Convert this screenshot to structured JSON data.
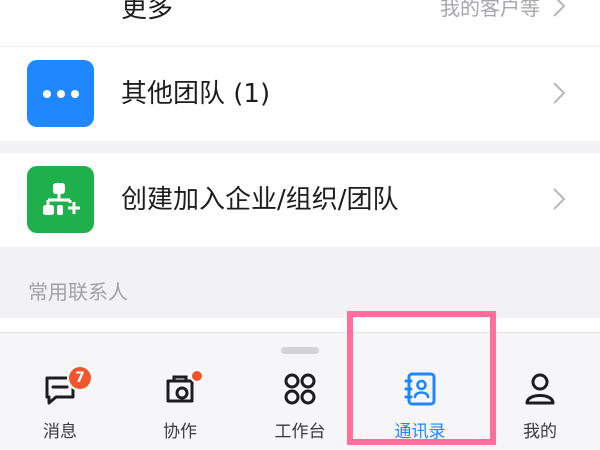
{
  "list": {
    "more": {
      "label": "更多",
      "hint": "我的客户等"
    },
    "other_teams": {
      "label": "其他团队 (1)",
      "icon": "more-dots-icon"
    },
    "create_join": {
      "label": "创建加入企业/组织/团队",
      "icon": "org-add-icon"
    }
  },
  "section": {
    "title": "常用联系人"
  },
  "tabbar": {
    "tabs": [
      {
        "label": "消息",
        "icon": "message-icon",
        "badge": "7"
      },
      {
        "label": "协作",
        "icon": "collaborate-icon",
        "dot": true
      },
      {
        "label": "工作台",
        "icon": "workbench-icon"
      },
      {
        "label": "通讯录",
        "icon": "contacts-icon",
        "active": true
      },
      {
        "label": "我的",
        "icon": "profile-icon"
      }
    ]
  },
  "colors": {
    "accent": "#1f87ff",
    "green": "#20b04b",
    "badge": "#f2542d",
    "highlight": "#ff6f9c"
  }
}
